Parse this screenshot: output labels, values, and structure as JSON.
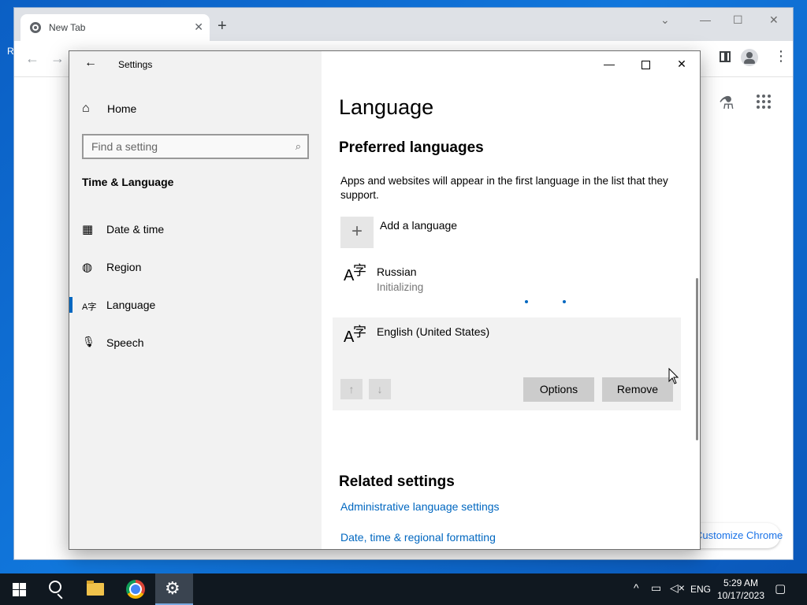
{
  "chrome": {
    "tab_title": "New Tab",
    "tab_close": "✕",
    "new_tab": "+",
    "nav_back": "←",
    "nav_forward": "→",
    "reload_letter": "R",
    "customize_label": "Customize Chrome",
    "caption_menu": "⌄",
    "caption_min": "—",
    "caption_max": "☐",
    "caption_close": "✕"
  },
  "settings": {
    "title": "Settings",
    "back": "←",
    "home": "Home",
    "search": {
      "placeholder": "Find a setting",
      "value": ""
    },
    "section": "Time & Language",
    "nav": [
      {
        "label": "Date & time",
        "icon": "calendar-clock-icon",
        "glyph": "▦"
      },
      {
        "label": "Region",
        "icon": "globe-icon",
        "glyph": "◍"
      },
      {
        "label": "Language",
        "icon": "language-icon",
        "glyph": "A字"
      },
      {
        "label": "Speech",
        "icon": "microphone-icon",
        "glyph": "🎙"
      }
    ],
    "caption": {
      "min": "—",
      "close": "✕"
    },
    "page_title": "Language",
    "preferred_heading": "Preferred languages",
    "preferred_desc": "Apps and websites will appear in the first language in the list that they support.",
    "add_language": "Add a language",
    "languages": [
      {
        "name": "Russian",
        "status": "Initializing"
      },
      {
        "name": "English (United States)",
        "status": ""
      }
    ],
    "buttons": {
      "up": "↑",
      "down": "↓",
      "options": "Options",
      "remove": "Remove"
    },
    "related_heading": "Related settings",
    "related_links": [
      "Administrative language settings",
      "Date, time & regional formatting"
    ]
  },
  "taskbar": {
    "input_lang": "ENG",
    "time": "5:29 AM",
    "date": "10/17/2023"
  },
  "colors": {
    "accent": "#0067c0",
    "desktop": "#0a63c9",
    "taskbar": "#101820"
  }
}
